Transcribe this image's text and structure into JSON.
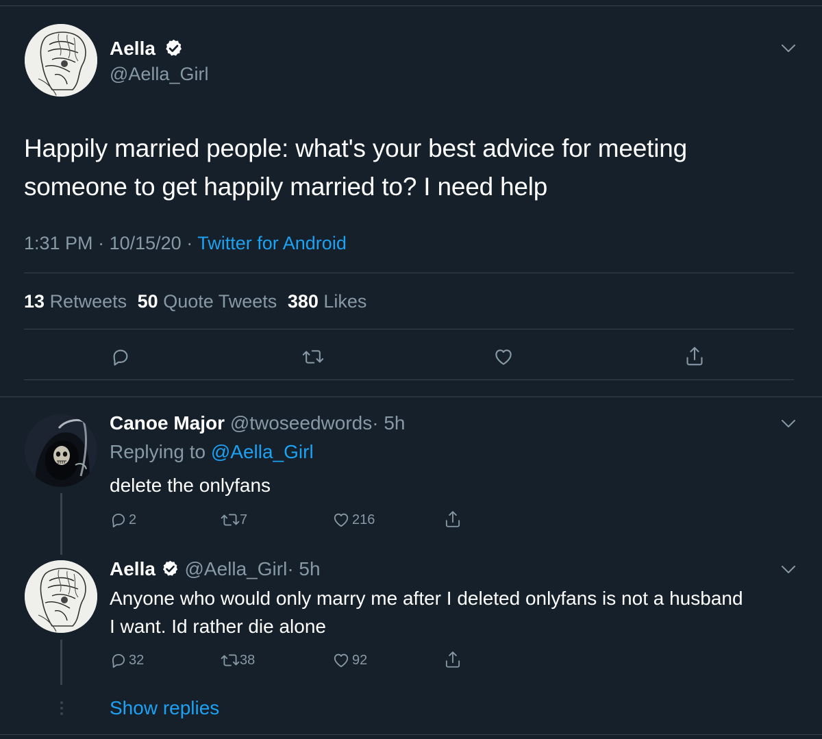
{
  "main_tweet": {
    "author_name": "Aella",
    "author_handle": "@Aella_Girl",
    "text_line1": "Happily married people: what's your best advice for meeting",
    "text_line2": "someone to get happily married to? I need help",
    "time": "1:31 PM",
    "date": "10/15/20",
    "separator": "·",
    "source": "Twitter for Android",
    "retweets_count": "13",
    "retweets_label": "Retweets",
    "quotes_count": "50",
    "quotes_label": "Quote Tweets",
    "likes_count": "380",
    "likes_label": "Likes"
  },
  "reply1": {
    "author_name": "Canoe Major",
    "author_handle": "@twoseedwords",
    "time": "· 5h",
    "replying_prefix": "Replying to",
    "replying_handle": "@Aella_Girl",
    "text": "delete the onlyfans",
    "reply_count": "2",
    "retweet_count": "7",
    "like_count": "216"
  },
  "reply2": {
    "author_name": "Aella",
    "author_handle": "@Aella_Girl",
    "time": "· 5h",
    "text_line1": "Anyone who would only marry me after I deleted onlyfans is not a husband",
    "text_line2": "I want. Id rather die alone",
    "reply_count": "32",
    "retweet_count": "38",
    "like_count": "92"
  },
  "show_replies": "Show replies",
  "icons": {
    "verified": "verified-badge-icon",
    "reply": "reply-icon",
    "retweet": "retweet-icon",
    "like": "heart-icon",
    "share": "share-icon",
    "more": "chevron-down-icon",
    "thread_dots": "vertical-dots-icon"
  },
  "colors": {
    "background": "#15202b",
    "divider": "#38444d",
    "muted_text": "#8899a6",
    "link": "#1da1f2"
  }
}
